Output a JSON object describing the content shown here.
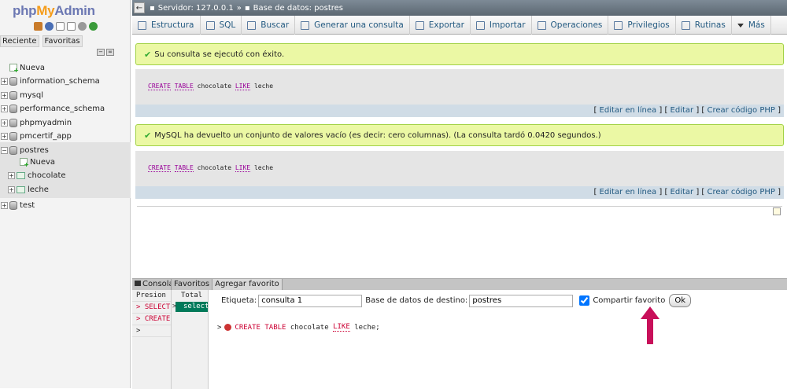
{
  "app": {
    "logo_php": "php",
    "logo_my": "My",
    "logo_admin": "Admin"
  },
  "nav": {
    "tabs": [
      "Reciente",
      "Favoritas"
    ],
    "items": [
      {
        "label": "Nueva",
        "kind": "new"
      },
      {
        "label": "information_schema",
        "kind": "db"
      },
      {
        "label": "mysql",
        "kind": "db"
      },
      {
        "label": "performance_schema",
        "kind": "db"
      },
      {
        "label": "phpmyadmin",
        "kind": "db"
      },
      {
        "label": "pmcertif_app",
        "kind": "db"
      },
      {
        "label": "postres",
        "kind": "db"
      },
      {
        "label": "Nueva",
        "kind": "new"
      },
      {
        "label": "chocolate",
        "kind": "table"
      },
      {
        "label": "leche",
        "kind": "table"
      },
      {
        "label": "test",
        "kind": "db"
      }
    ]
  },
  "breadcrumb": {
    "server": "Servidor: 127.0.0.1",
    "sep": "»",
    "database": "Base de datos: postres"
  },
  "tabs": [
    {
      "label": "Estructura",
      "icon": "structure-icon"
    },
    {
      "label": "SQL",
      "icon": "sql-icon"
    },
    {
      "label": "Buscar",
      "icon": "search-icon"
    },
    {
      "label": "Generar una consulta",
      "icon": "query-icon"
    },
    {
      "label": "Exportar",
      "icon": "export-icon"
    },
    {
      "label": "Importar",
      "icon": "import-icon"
    },
    {
      "label": "Operaciones",
      "icon": "wrench-icon"
    },
    {
      "label": "Privilegios",
      "icon": "privileges-icon"
    },
    {
      "label": "Rutinas",
      "icon": "routines-icon"
    },
    {
      "label": "Más",
      "icon": "dropdown-icon"
    }
  ],
  "results": [
    {
      "message": "Su consulta se ejecutó con éxito.",
      "sql": {
        "kw1": "CREATE",
        "kw2": "TABLE",
        "name": "chocolate",
        "kw3": "LIKE",
        "src": "leche"
      },
      "actions": [
        "Editar en línea",
        "Editar",
        "Crear código PHP"
      ]
    },
    {
      "message": "MySQL ha devuelto un conjunto de valores vacío (es decir: cero columnas). (La consulta tardó 0.0420 segundos.)",
      "sql": {
        "kw1": "CREATE",
        "kw2": "TABLE",
        "name": "chocolate",
        "kw3": "LIKE",
        "src": "leche"
      },
      "actions": [
        "Editar en línea",
        "Editar",
        "Crear código PHP"
      ]
    }
  ],
  "console": {
    "tabs": [
      "Consola",
      "Favoritos",
      "Agregar favorito"
    ],
    "col1": [
      "Presion",
      "> SELECT",
      "> CREATE",
      ">"
    ],
    "col2_header": "Total",
    "col2_selected": "select",
    "form": {
      "label_etiqueta": "Etiqueta:",
      "etiqueta_value": "consulta 1",
      "label_db": "Base de datos de destino:",
      "db_value": "postres",
      "label_share": "Compartir favorito",
      "share_checked": true,
      "ok": "Ok"
    },
    "query": {
      "prefix": ">",
      "kw1": "CREATE",
      "kw2": "TABLE",
      "name": "chocolate",
      "kw3": "LIKE",
      "src": "leche;"
    }
  },
  "colors": {
    "accent_arrow": "#c8105a",
    "success_bg": "#ebf8a4",
    "link": "#235a81"
  }
}
